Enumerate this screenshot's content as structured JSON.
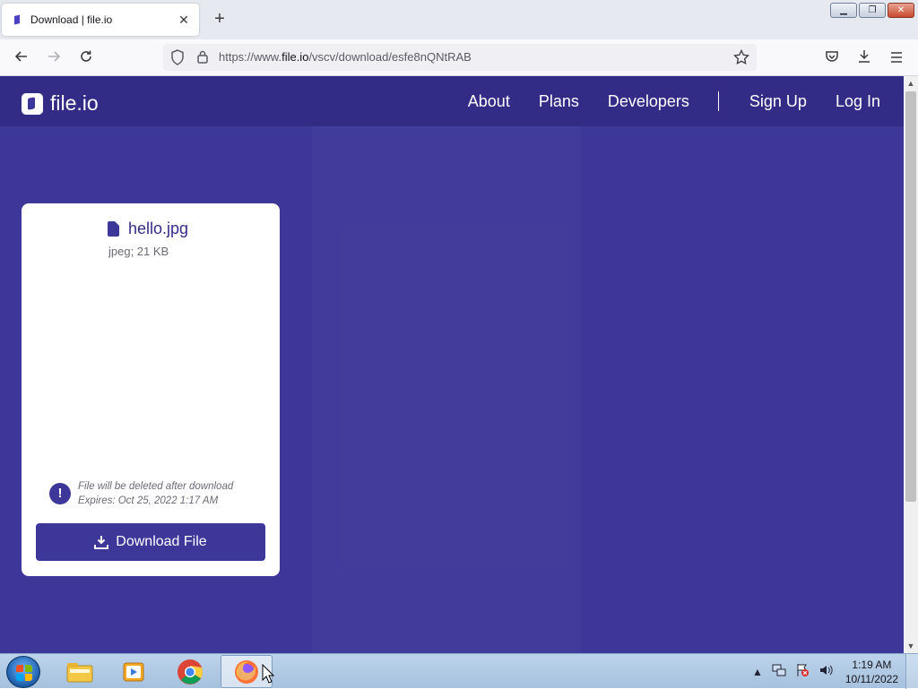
{
  "browser": {
    "tab_title": "Download | file.io",
    "url_prefix": "https://www.",
    "url_host": "file.io",
    "url_path": "/vscv/download/esfe8nQNtRAB",
    "window_buttons": {
      "minimize": "▁",
      "restore": "❐",
      "close": "✕"
    }
  },
  "site": {
    "logo_text": "file.io",
    "nav": {
      "about": "About",
      "plans": "Plans",
      "developers": "Developers",
      "signup": "Sign Up",
      "login": "Log In"
    },
    "accent_color": "#3d3799",
    "header_color": "#332c87"
  },
  "card": {
    "file_name": "hello.jpg",
    "file_meta": "jpeg; 21 KB",
    "notice_line1": "File will be deleted after download",
    "notice_line2": "Expires: Oct 25, 2022 1:17 AM",
    "download_label": "Download File"
  },
  "taskbar": {
    "time": "1:19 AM",
    "date": "10/11/2022"
  }
}
